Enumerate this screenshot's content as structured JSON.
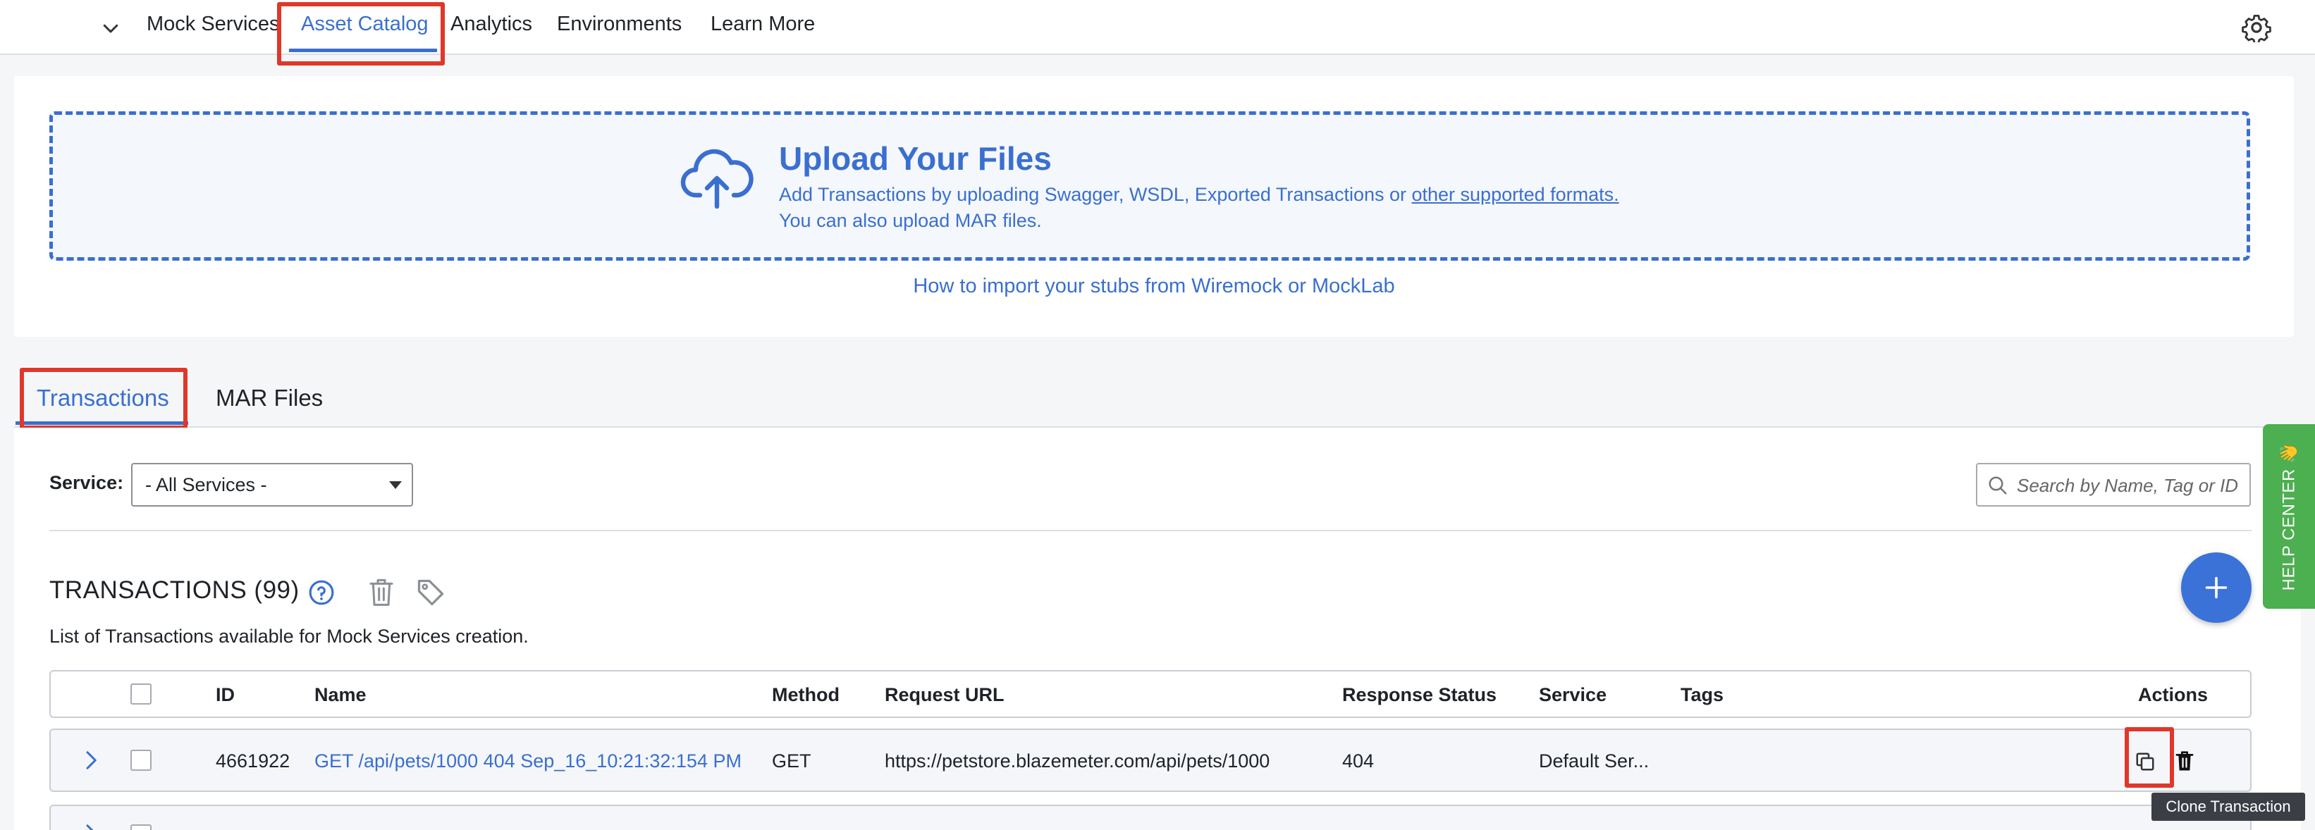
{
  "nav": {
    "items": [
      {
        "label": "Mock Services",
        "active": false
      },
      {
        "label": "Asset Catalog",
        "active": true
      },
      {
        "label": "Analytics",
        "active": false
      },
      {
        "label": "Environments",
        "active": false
      },
      {
        "label": "Learn More",
        "active": false
      }
    ]
  },
  "upload": {
    "title": "Upload Your Files",
    "line1_prefix": "Add Transactions by uploading Swagger, WSDL, Exported Transactions or ",
    "line1_link": "other supported formats.",
    "line2": "You can also upload MAR files.",
    "import_link": "How to import your stubs from Wiremock or MockLab"
  },
  "tabs": [
    {
      "label": "Transactions",
      "active": true
    },
    {
      "label": "MAR Files",
      "active": false
    }
  ],
  "filters": {
    "service_label": "Service:",
    "service_value": "- All Services -",
    "search_placeholder": "Search by Name, Tag or ID"
  },
  "transactions": {
    "title": "TRANSACTIONS (99)",
    "description": "List of Transactions available for Mock Services creation."
  },
  "table": {
    "columns": {
      "id": "ID",
      "name": "Name",
      "method": "Method",
      "request_url": "Request URL",
      "response_status": "Response Status",
      "service": "Service",
      "tags": "Tags",
      "actions": "Actions"
    },
    "rows": [
      {
        "id": "4661922",
        "name": "GET /api/pets/1000 404 Sep_16_10:21:32:154 PM",
        "method": "GET",
        "request_url": "https://petstore.blazemeter.com/api/pets/1000",
        "response_status": "404",
        "service": "Default Ser...",
        "tags": ""
      }
    ]
  },
  "tooltip": "Clone Transaction",
  "help_center": "HELP CENTER 👋",
  "colors": {
    "accent": "#3a6fd0",
    "highlight": "#e0372a",
    "help_center": "#4caf50"
  }
}
